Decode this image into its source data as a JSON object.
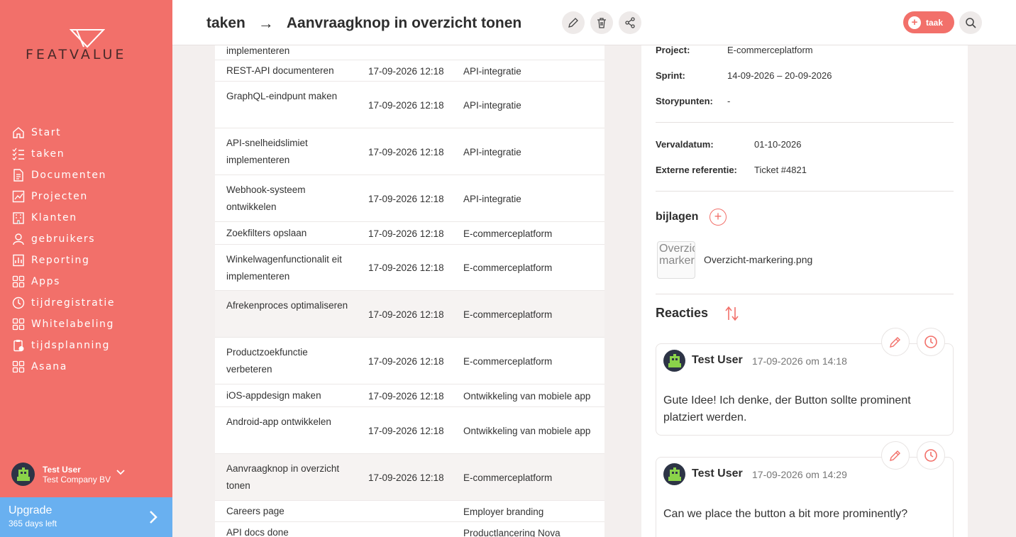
{
  "brand": {
    "logo_text": "FEATVALUE",
    "accent": "#f2706a",
    "upgrade_color": "#69b0f0"
  },
  "sidebar": {
    "items": [
      {
        "label": "Start",
        "icon": "home-icon"
      },
      {
        "label": "taken",
        "icon": "checklist-icon"
      },
      {
        "label": "Documenten",
        "icon": "document-icon"
      },
      {
        "label": "Projecten",
        "icon": "chart-icon"
      },
      {
        "label": "Klanten",
        "icon": "building-icon"
      },
      {
        "label": "gebruikers",
        "icon": "user-icon"
      },
      {
        "label": "Reporting",
        "icon": "report-icon"
      },
      {
        "label": "Apps",
        "icon": "apps-icon"
      },
      {
        "label": "tijdregistratie",
        "icon": "timer-icon"
      },
      {
        "label": "Whitelabeling",
        "icon": "grid-icon"
      },
      {
        "label": "tijdsplanning",
        "icon": "clipboard-clock-icon"
      },
      {
        "label": "Asana",
        "icon": "grid-icon"
      }
    ],
    "user": {
      "name": "Test User",
      "company": "Test Company BV"
    },
    "upgrade": {
      "title": "Upgrade",
      "subtitle": "365 days left"
    }
  },
  "header": {
    "section": "taken",
    "arrow": "→",
    "task_title": "Aanvraagknop in overzicht tonen",
    "new_task_label": "taak"
  },
  "tasks": [
    {
      "name": "implementeren",
      "date": "",
      "project": ""
    },
    {
      "name": "REST-API documenteren",
      "date": "17-09-2026 12:18",
      "project": "API-integratie"
    },
    {
      "name": "GraphQL-eindpunt maken",
      "date": "17-09-2026 12:18",
      "project": "API-integratie"
    },
    {
      "name": "API-snelheidslimiet implementeren",
      "date": "17-09-2026 12:18",
      "project": "API-integratie"
    },
    {
      "name": "Webhook-systeem ontwikkelen",
      "date": "17-09-2026 12:18",
      "project": "API-integratie"
    },
    {
      "name": "Zoekfilters opslaan",
      "date": "17-09-2026 12:18",
      "project": "E-commerceplatform"
    },
    {
      "name": "Winkelwagenfunctionalit eit implementeren",
      "date": "17-09-2026 12:18",
      "project": "E-commerceplatform"
    },
    {
      "name": "Afrekenproces optimaliseren",
      "date": "17-09-2026 12:18",
      "project": "E-commerceplatform"
    },
    {
      "name": "Productzoekfunctie verbeteren",
      "date": "17-09-2026 12:18",
      "project": "E-commerceplatform"
    },
    {
      "name": "iOS-appdesign maken",
      "date": "17-09-2026 12:18",
      "project": "Ontwikkeling van mobiele app"
    },
    {
      "name": "Android-app ontwikkelen",
      "date": "17-09-2026 12:18",
      "project": "Ontwikkeling van mobiele app"
    },
    {
      "name": "Aanvraagknop in overzicht tonen",
      "date": "17-09-2026 12:18",
      "project": "E-commerceplatform"
    },
    {
      "name": "Careers page",
      "date": "",
      "project": "Employer branding"
    },
    {
      "name": "API docs done",
      "date": "",
      "project": "Productlancering Nova"
    }
  ],
  "detail": {
    "project_label": "Project:",
    "project_value": "E-commerceplatform",
    "sprint_label": "Sprint:",
    "sprint_value": "14-09-2026 – 20-09-2026",
    "story_label": "Storypunten:",
    "story_value": "-",
    "due_label": "Vervaldatum:",
    "due_value": "01-10-2026",
    "ref_label": "Externe referentie:",
    "ref_value": "Ticket #4821",
    "attachments_title": "bijlagen",
    "attachment_alt": "Overzicht-markering",
    "attachment_name": "Overzicht-markering.png",
    "reactions_title": "Reacties"
  },
  "comments": [
    {
      "author": "Test User",
      "time": "17-09-2026 om 14:18",
      "text": "Gute Idee! Ich denke, der Button sollte prominent platziert werden."
    },
    {
      "author": "Test User",
      "time": "17-09-2026 om 14:29",
      "text": "Can we place the button a bit more prominently?"
    }
  ]
}
